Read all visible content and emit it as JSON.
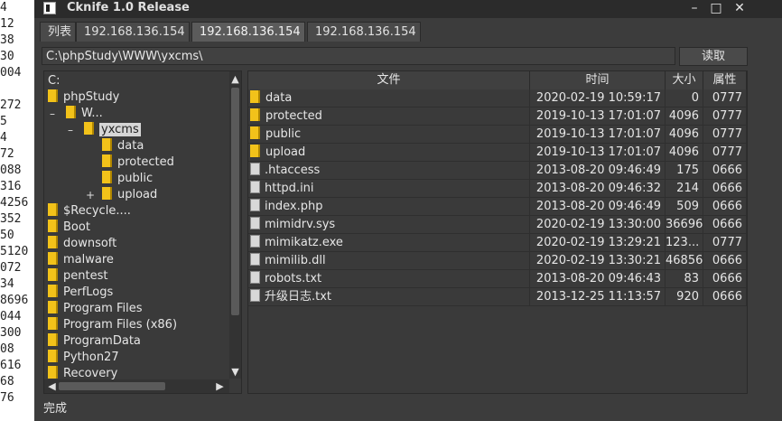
{
  "background_numbers": [
    "4",
    "12",
    "38",
    "30",
    "004",
    "",
    "272",
    "5",
    "4",
    "72",
    "088",
    "316",
    "4256",
    "352",
    "50",
    "5120",
    "072",
    "34",
    "8696",
    "044",
    "300",
    "08",
    "616",
    "68",
    "76"
  ],
  "window": {
    "title": "Cknife 1.0 Release",
    "controls": {
      "minimize": "–",
      "maximize": "□",
      "close": "✕"
    }
  },
  "tabs": [
    {
      "label": "列表",
      "active": false
    },
    {
      "label": "192.168.136.154",
      "active": false
    },
    {
      "label": "192.168.136.154",
      "active": true
    },
    {
      "label": "192.168.136.154",
      "active": false
    }
  ],
  "path": {
    "value": "C:\\phpStudy\\WWW\\yxcms\\",
    "button": "读取"
  },
  "tree": {
    "items": [
      {
        "label": "C:",
        "depth": 0,
        "folder": false,
        "toggle": ""
      },
      {
        "label": "phpStudy",
        "depth": 0,
        "folder": true,
        "toggle": ""
      },
      {
        "label": "W...",
        "depth": 1,
        "folder": true,
        "toggle": "–"
      },
      {
        "label": "yxcms",
        "depth": 2,
        "folder": true,
        "toggle": "–",
        "selected": true
      },
      {
        "label": "data",
        "depth": 3,
        "folder": true,
        "toggle": ""
      },
      {
        "label": "protected",
        "depth": 3,
        "folder": true,
        "toggle": ""
      },
      {
        "label": "public",
        "depth": 3,
        "folder": true,
        "toggle": ""
      },
      {
        "label": "upload",
        "depth": 3,
        "folder": true,
        "toggle": "+"
      },
      {
        "label": "$Recycle....",
        "depth": 0,
        "folder": true,
        "toggle": ""
      },
      {
        "label": "Boot",
        "depth": 0,
        "folder": true,
        "toggle": ""
      },
      {
        "label": "downsoft",
        "depth": 0,
        "folder": true,
        "toggle": ""
      },
      {
        "label": "malware",
        "depth": 0,
        "folder": true,
        "toggle": ""
      },
      {
        "label": "pentest",
        "depth": 0,
        "folder": true,
        "toggle": ""
      },
      {
        "label": "PerfLogs",
        "depth": 0,
        "folder": true,
        "toggle": ""
      },
      {
        "label": "Program Files",
        "depth": 0,
        "folder": true,
        "toggle": ""
      },
      {
        "label": "Program Files (x86)",
        "depth": 0,
        "folder": true,
        "toggle": ""
      },
      {
        "label": "ProgramData",
        "depth": 0,
        "folder": true,
        "toggle": ""
      },
      {
        "label": "Python27",
        "depth": 0,
        "folder": true,
        "toggle": ""
      },
      {
        "label": "Recovery",
        "depth": 0,
        "folder": true,
        "toggle": ""
      }
    ]
  },
  "files": {
    "columns": [
      "文件",
      "时间",
      "大小",
      "属性"
    ],
    "rows": [
      {
        "name": "data",
        "type": "folder",
        "time": "2020-02-19 10:59:17",
        "size": "0",
        "attr": "0777"
      },
      {
        "name": "protected",
        "type": "folder",
        "time": "2019-10-13 17:01:07",
        "size": "4096",
        "attr": "0777"
      },
      {
        "name": "public",
        "type": "folder",
        "time": "2019-10-13 17:01:07",
        "size": "4096",
        "attr": "0777"
      },
      {
        "name": "upload",
        "type": "folder",
        "time": "2019-10-13 17:01:07",
        "size": "4096",
        "attr": "0777"
      },
      {
        "name": ".htaccess",
        "type": "file",
        "time": "2013-08-20 09:46:49",
        "size": "175",
        "attr": "0666"
      },
      {
        "name": "httpd.ini",
        "type": "file",
        "time": "2013-08-20 09:46:32",
        "size": "214",
        "attr": "0666"
      },
      {
        "name": "index.php",
        "type": "file",
        "time": "2013-08-20 09:46:49",
        "size": "509",
        "attr": "0666"
      },
      {
        "name": "mimidrv.sys",
        "type": "file",
        "time": "2020-02-19 13:30:00",
        "size": "36696",
        "attr": "0666"
      },
      {
        "name": "mimikatz.exe",
        "type": "file",
        "time": "2020-02-19 13:29:21",
        "size": "123...",
        "attr": "0777"
      },
      {
        "name": "mimilib.dll",
        "type": "file",
        "time": "2020-02-19 13:30:21",
        "size": "46856",
        "attr": "0666"
      },
      {
        "name": "robots.txt",
        "type": "file",
        "time": "2013-08-20 09:46:43",
        "size": "83",
        "attr": "0666"
      },
      {
        "name": "升级日志.txt",
        "type": "file",
        "time": "2013-12-25 11:13:57",
        "size": "920",
        "attr": "0666"
      }
    ]
  },
  "status": "完成",
  "colors": {
    "window_bg": "#3c3c3c",
    "folder": "#f2c21a",
    "titlebar": "#2b2b2b"
  }
}
